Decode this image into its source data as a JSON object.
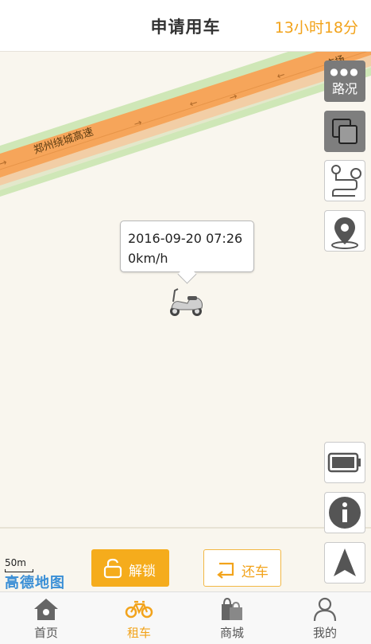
{
  "header": {
    "title": "申请用车",
    "timer": "13小时18分"
  },
  "map": {
    "road_name": "郑州绕城高速",
    "road_name_2": "市场",
    "vehicle_popup": {
      "time": "2016-09-20 07:26",
      "speed": "0km/h"
    },
    "scale": "50m",
    "provider_logo": "高德地图"
  },
  "controls": {
    "traffic_label": "路况"
  },
  "actions": {
    "unlock_label": "解锁",
    "return_label": "还车"
  },
  "tabs": [
    {
      "label": "首页"
    },
    {
      "label": "租车"
    },
    {
      "label": "商城"
    },
    {
      "label": "我的"
    }
  ],
  "colors": {
    "accent": "#f2a31b",
    "road": "#f6a559",
    "road_edge": "#b5dca0"
  }
}
